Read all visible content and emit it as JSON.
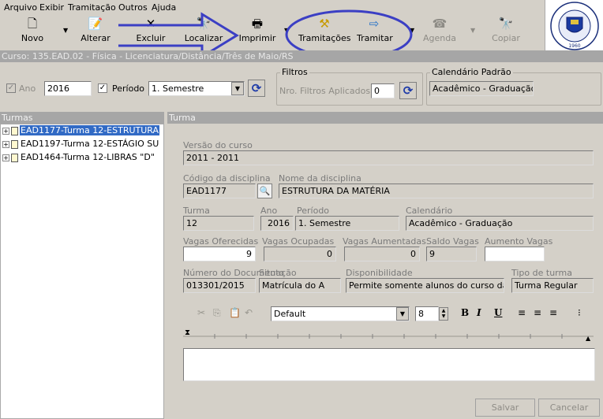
{
  "menu": [
    "Arquivo",
    "Exibir",
    "Tramitação",
    "Outros",
    "Ajuda"
  ],
  "toolbar": {
    "novo": "Novo",
    "alterar": "Alterar",
    "excluir": "Excluir",
    "localizar": "Localizar",
    "imprimir": "Imprimir",
    "tramitacoes": "Tramitações",
    "tramitar": "Tramitar",
    "agenda": "Agenda",
    "copiar": "Copiar"
  },
  "logo": {
    "text": "Universidade Federal de Santa Maria",
    "year": "1960"
  },
  "curso": "Curso: 135.EAD.02 - Física - Licenciatura/Distância/Três de Maio/RS",
  "filters": {
    "ano_label": "Ano",
    "ano_value": "2016",
    "periodo_label": "Período",
    "periodo_value": "1. Semestre",
    "filtros_label": "Filtros",
    "filtros_text": "Nro. Filtros Aplicados",
    "filtros_count": "0",
    "calendario_label": "Calendário Padrão",
    "calendario_value": "Acadêmico - Graduação"
  },
  "turmas_header": "Turmas",
  "turma_header": "Turma",
  "tree": [
    {
      "label": "EAD1177-Turma 12-ESTRUTURA",
      "selected": true
    },
    {
      "label": "EAD1197-Turma 12-ESTÁGIO SU",
      "selected": false
    },
    {
      "label": "EAD1464-Turma 12-LIBRAS \"D\"",
      "selected": false
    }
  ],
  "form": {
    "versao_label": "Versão do curso",
    "versao_value": "2011 - 2011",
    "codigo_label": "Código da disciplina",
    "codigo_value": "EAD1177",
    "nome_label": "Nome da disciplina",
    "nome_value": "ESTRUTURA DA MATÉRIA",
    "turma_label": "Turma",
    "turma_value": "12",
    "ano_label": "Ano",
    "ano_value": "2016",
    "periodo_label": "Período",
    "periodo_value": "1. Semestre",
    "calendario_label": "Calendário",
    "calendario_value": "Acadêmico - Graduação",
    "vagas_of_label": "Vagas Oferecidas",
    "vagas_of_value": "9",
    "vagas_oc_label": "Vagas Ocupadas",
    "vagas_oc_value": "0",
    "vagas_au_label": "Vagas Aumentadas",
    "vagas_au_value": "0",
    "saldo_label": "Saldo Vagas",
    "saldo_value": "9",
    "aumento_label": "Aumento Vagas",
    "aumento_value": "",
    "numdoc_label": "Número do Documento",
    "numdoc_value": "013301/2015",
    "situacao_label": "Situação",
    "situacao_value": "Matrícula do A",
    "disp_label": "Disponibilidade",
    "disp_value": "Permite somente alunos do curso da turr",
    "tipo_label": "Tipo de turma",
    "tipo_value": "Turma Regular"
  },
  "editor": {
    "font": "Default",
    "size": "8",
    "bold": "B",
    "italic": "I",
    "underline": "U",
    "text": ""
  },
  "buttons": {
    "salvar": "Salvar",
    "cancelar": "Cancelar"
  },
  "colors": {
    "selection": "#316ac5",
    "header": "#a6a6a6",
    "annotation": "#3b3fc4"
  }
}
